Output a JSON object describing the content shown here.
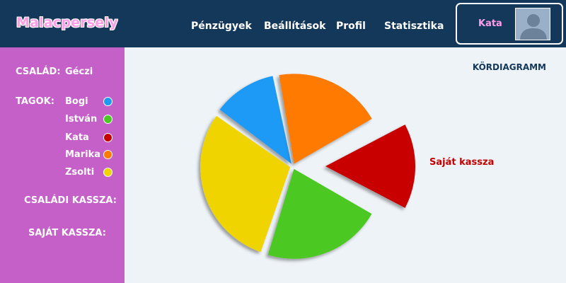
{
  "app": {
    "logo": "Malacpersely"
  },
  "nav": {
    "items": [
      "Pénzügyek",
      "Beállítások",
      "Profil",
      "Statisztika"
    ]
  },
  "user": {
    "name": "Kata"
  },
  "sidebar": {
    "family_label": "CSALÁD:",
    "family_name": "Géczi",
    "members_label": "TAGOK:",
    "members": [
      {
        "name": "Bogi",
        "color": "#1e9af5"
      },
      {
        "name": "István",
        "color": "#4cc824"
      },
      {
        "name": "Kata",
        "color": "#c80000"
      },
      {
        "name": "Marika",
        "color": "#ff7a00"
      },
      {
        "name": "Zsolti",
        "color": "#f0d400"
      }
    ],
    "family_fund_label": "CSALÁDI KASSZA:",
    "own_fund_label": "SAJÁT KASSZA:"
  },
  "main": {
    "chart_title": "KÖRDIAGRAMM",
    "callout": "Saját kassza"
  },
  "chart_data": {
    "type": "pie",
    "labels": [
      "Bogi",
      "Marika",
      "Kata",
      "István",
      "Zsolti"
    ],
    "values": [
      12,
      20,
      16,
      22,
      30
    ],
    "colors": [
      "#1e9af5",
      "#ff7a00",
      "#c80000",
      "#4cc824",
      "#f0d400"
    ],
    "exploded": "Kata"
  }
}
